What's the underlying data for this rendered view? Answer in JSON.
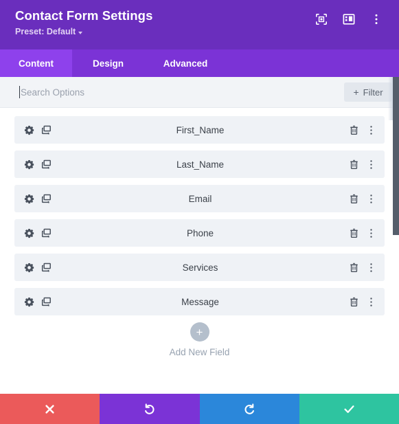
{
  "header": {
    "title": "Contact Form Settings",
    "preset_label": "Preset: Default",
    "icons": [
      {
        "name": "focus-target-icon",
        "label": "Focus"
      },
      {
        "name": "layout-panel-icon",
        "label": "Layout"
      },
      {
        "name": "more-vertical-icon",
        "label": "More options"
      }
    ]
  },
  "tabs": [
    {
      "label": "Content",
      "active": true
    },
    {
      "label": "Design",
      "active": false
    },
    {
      "label": "Advanced",
      "active": false
    }
  ],
  "search": {
    "placeholder": "Search Options",
    "value": "",
    "filter_label": "Filter",
    "filter_plus": "+"
  },
  "fields": [
    {
      "label": "First_Name"
    },
    {
      "label": "Last_Name"
    },
    {
      "label": "Email"
    },
    {
      "label": "Phone"
    },
    {
      "label": "Services"
    },
    {
      "label": "Message"
    }
  ],
  "add_new": {
    "plus": "+",
    "label": "Add New Field"
  },
  "footer": {
    "cancel_label": "Cancel",
    "undo_label": "Undo",
    "redo_label": "Redo",
    "save_label": "Save"
  },
  "colors": {
    "header_purple": "#6a2ebd",
    "tabbar_purple": "#7b33d6",
    "tab_active_purple": "#8e41ec",
    "row_bg": "#eff2f6",
    "search_bg": "#f2f4f7",
    "cancel_red": "#eb5a5a",
    "undo_purple": "#7b33d6",
    "redo_blue": "#2b87da",
    "save_green": "#2ec4a0",
    "add_circle_gray": "#b4bfcc",
    "scrollbar_thumb": "#555e6b"
  }
}
